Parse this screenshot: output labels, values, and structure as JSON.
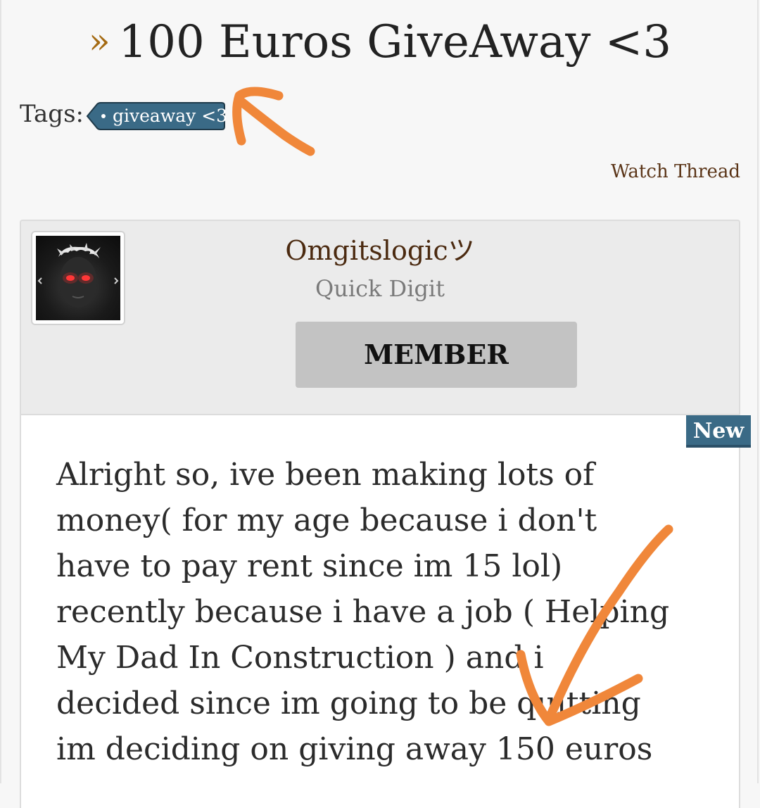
{
  "thread": {
    "title_prefix": "»",
    "title": "100 Euros GiveAway <3",
    "tags_label": "Tags:",
    "tags": [
      "giveaway <3"
    ],
    "watch_label": "Watch Thread"
  },
  "post": {
    "username": "Omgitslogicツ",
    "user_title": "Quick Digit",
    "rank": "MEMBER",
    "badge": "New",
    "message": "Alright so, ive been making lots of\nmoney( for my age because i don't\nhave to pay rent since im 15 lol)\nrecently because i have a job ( Helping\nMy Dad In Construction ) and i\ndecided since im going to be quitting\nim deciding on giving away 150 euros"
  },
  "colors": {
    "accent": "#a46a12",
    "tag_bg": "#3a6a86",
    "rank_bg": "#c3c3c3",
    "annotation": "#f0873a"
  }
}
